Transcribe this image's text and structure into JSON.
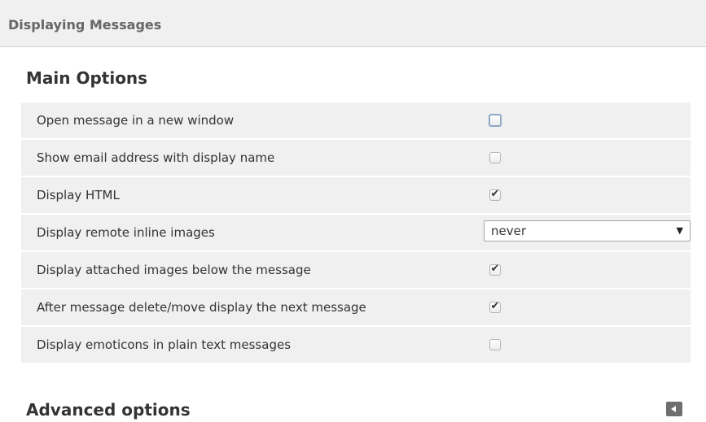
{
  "header": {
    "title": "Displaying Messages"
  },
  "main_section": {
    "title": "Main Options"
  },
  "options": [
    {
      "label": "Open message in a new window",
      "checked": false,
      "focused": true
    },
    {
      "label": "Show email address with display name",
      "checked": false
    },
    {
      "label": "Display HTML",
      "checked": true
    },
    {
      "label": "Display remote inline images",
      "select_value": "never"
    },
    {
      "label": "Display attached images below the message",
      "checked": true
    },
    {
      "label": "After message delete/move display the next message",
      "checked": true
    },
    {
      "label": "Display emoticons in plain text messages",
      "checked": false
    }
  ],
  "check_glyph": "✔",
  "advanced_section": {
    "title": "Advanced options",
    "icon": "collapse-left-icon"
  }
}
